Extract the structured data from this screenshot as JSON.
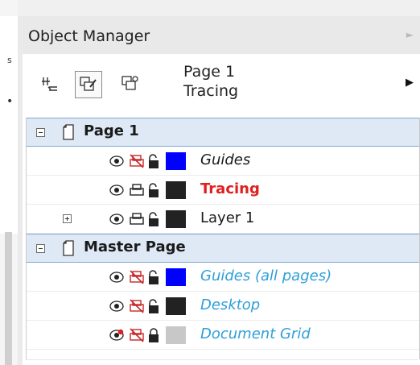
{
  "panel": {
    "title": "Object Manager"
  },
  "left_strip": {
    "glyph_s": "s",
    "glyph_dot": "•"
  },
  "toolbar": {
    "current_page": "Page 1",
    "current_layer": "Tracing",
    "tools": [
      "layer-properties-icon",
      "edit-across-layers-icon",
      "layer-manager-view-icon"
    ]
  },
  "tree": {
    "pages": [
      {
        "name": "Page 1",
        "expanded": true,
        "layers": [
          {
            "name": "Guides",
            "style": "italic",
            "color": "#0000ff",
            "visible": true,
            "printable": false,
            "locked": true
          },
          {
            "name": "Tracing",
            "style": "active",
            "color": "#222222",
            "visible": true,
            "printable": true,
            "locked": true
          },
          {
            "name": "Layer 1",
            "style": "normal",
            "color": "#222222",
            "visible": true,
            "printable": true,
            "locked": true,
            "has_children": true
          }
        ]
      },
      {
        "name": "Master Page",
        "expanded": true,
        "layers": [
          {
            "name": "Guides (all pages)",
            "style": "master",
            "color": "#0000ff",
            "visible": true,
            "printable": false,
            "locked": true
          },
          {
            "name": "Desktop",
            "style": "master",
            "color": "#222222",
            "visible": true,
            "printable": false,
            "locked": true
          },
          {
            "name": "Document Grid",
            "style": "master",
            "color": "#c8c8c8",
            "visible": false,
            "printable": false,
            "locked": true
          }
        ]
      }
    ]
  },
  "colors": {
    "page_row_bg": "#dfe9f5",
    "active_layer": "#e02020",
    "master_layer": "#2f9fd8"
  }
}
